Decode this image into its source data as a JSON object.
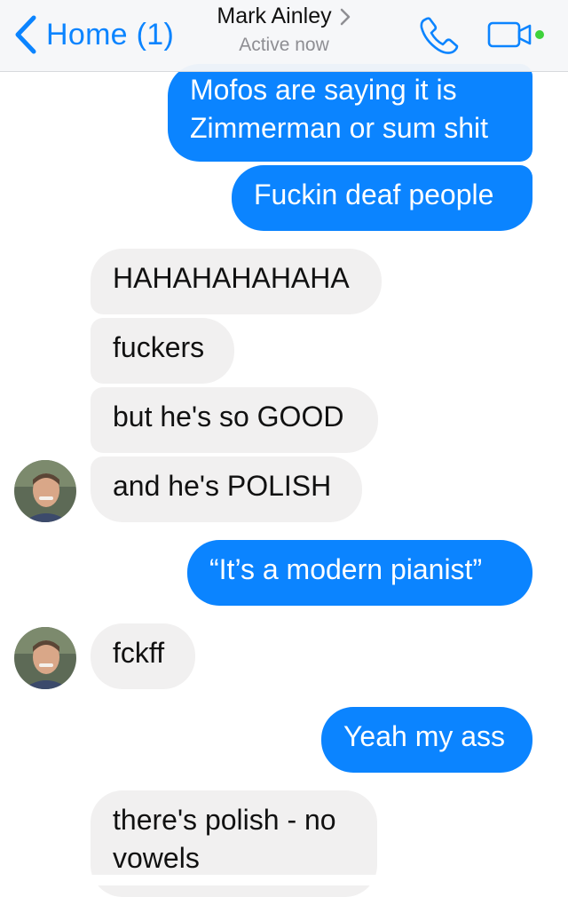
{
  "header": {
    "back_label": "Home (1)",
    "contact_name": "Mark Ainley",
    "status": "Active now",
    "accent_color": "#0b84ff",
    "active_indicator_color": "#3ed23b",
    "icons": [
      "chevron-left-icon",
      "chevron-right-icon",
      "phone-icon",
      "video-camera-icon"
    ]
  },
  "messages": [
    {
      "sender": "me",
      "text": "Mofos are saying it is\nZimmerman or sum shit"
    },
    {
      "sender": "me",
      "text": "Fuckin deaf people"
    },
    {
      "sender": "contact",
      "text": "HAHAHAHAHAHA"
    },
    {
      "sender": "contact",
      "text": "fuckers"
    },
    {
      "sender": "contact",
      "text": "but he's so GOOD"
    },
    {
      "sender": "contact",
      "text": "and he's POLISH"
    },
    {
      "sender": "me",
      "text": "“It’s a modern pianist”"
    },
    {
      "sender": "contact",
      "text": "fckff"
    },
    {
      "sender": "me",
      "text": "Yeah my ass"
    },
    {
      "sender": "contact",
      "text": "there's polish - no\nvowels"
    }
  ],
  "colors": {
    "outgoing_bubble": "#0b84ff",
    "incoming_bubble": "#f1f0f0"
  }
}
